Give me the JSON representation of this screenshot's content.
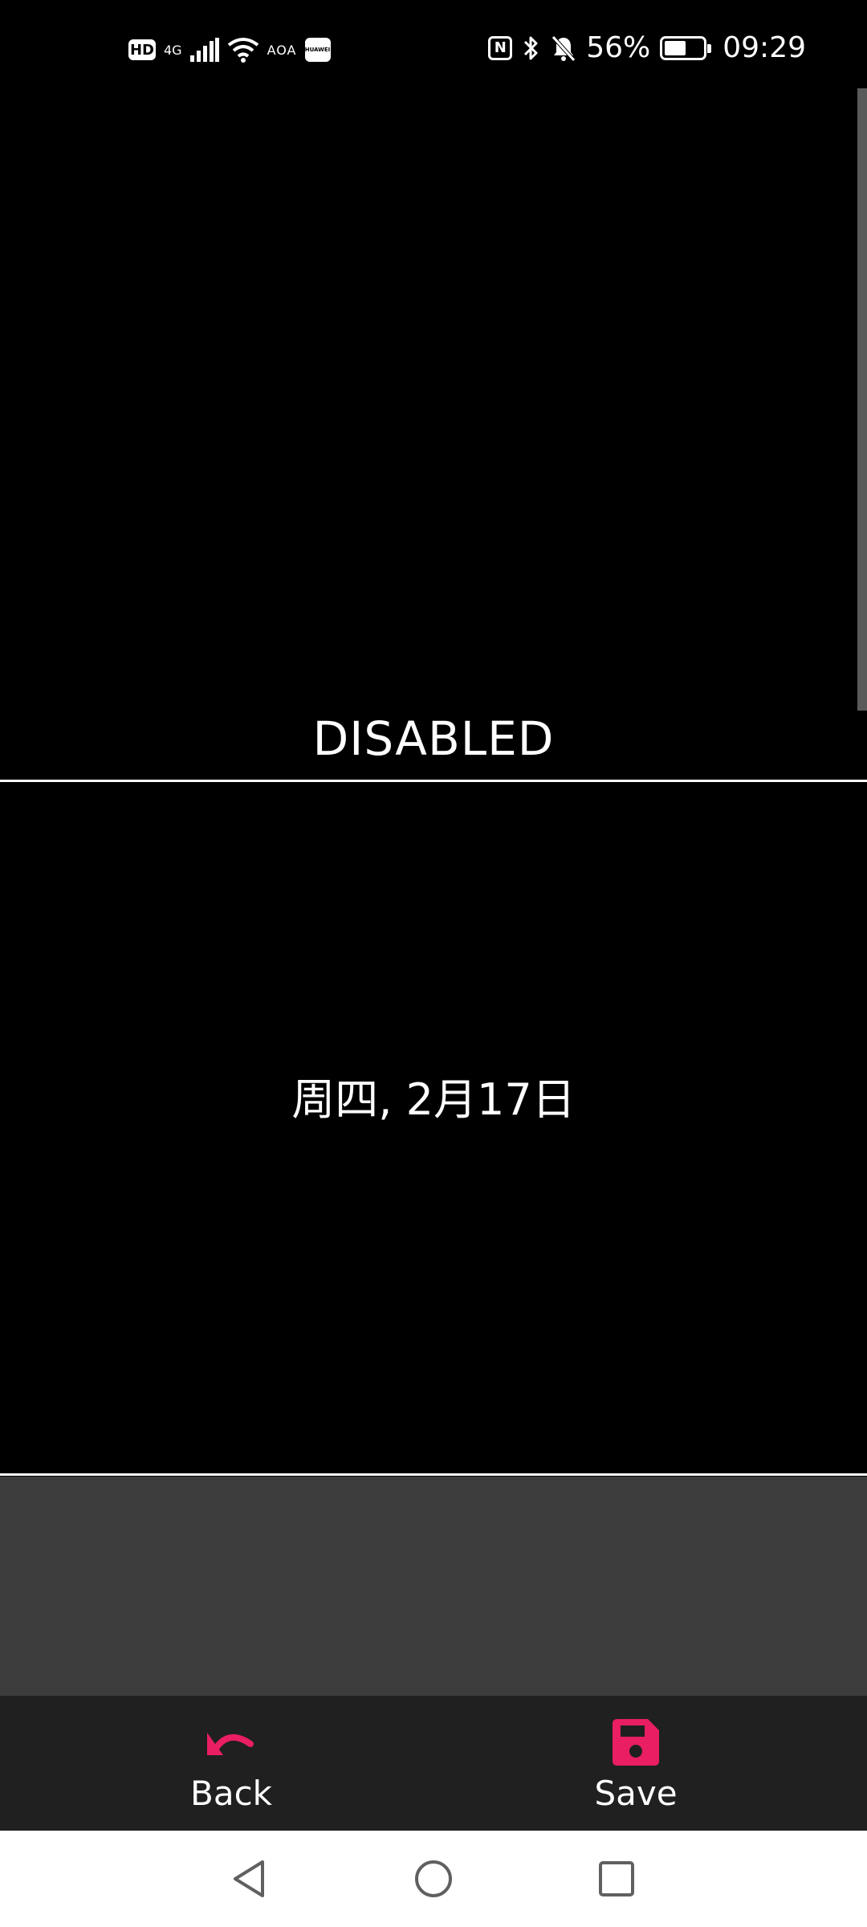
{
  "status_bar": {
    "hd": "HD",
    "network": "4G",
    "aoa": "AOA",
    "huawei": "HUAWEI",
    "nfc": "N",
    "battery_percent": "56%",
    "battery_level": 0.56,
    "time": "09:29"
  },
  "main": {
    "status_label": "DISABLED",
    "date_label": "周四, 2月17日"
  },
  "action_bar": {
    "back_label": "Back",
    "save_label": "Save"
  },
  "colors": {
    "accent": "#e91e63",
    "background": "#000000",
    "panel_gray": "#3c3c3c",
    "action_bar": "#202020"
  },
  "icons": {
    "back": "undo-arrow-icon",
    "save": "floppy-disk-icon",
    "nav_back": "triangle-back-icon",
    "nav_home": "circle-home-icon",
    "nav_recent": "square-recent-icon"
  }
}
